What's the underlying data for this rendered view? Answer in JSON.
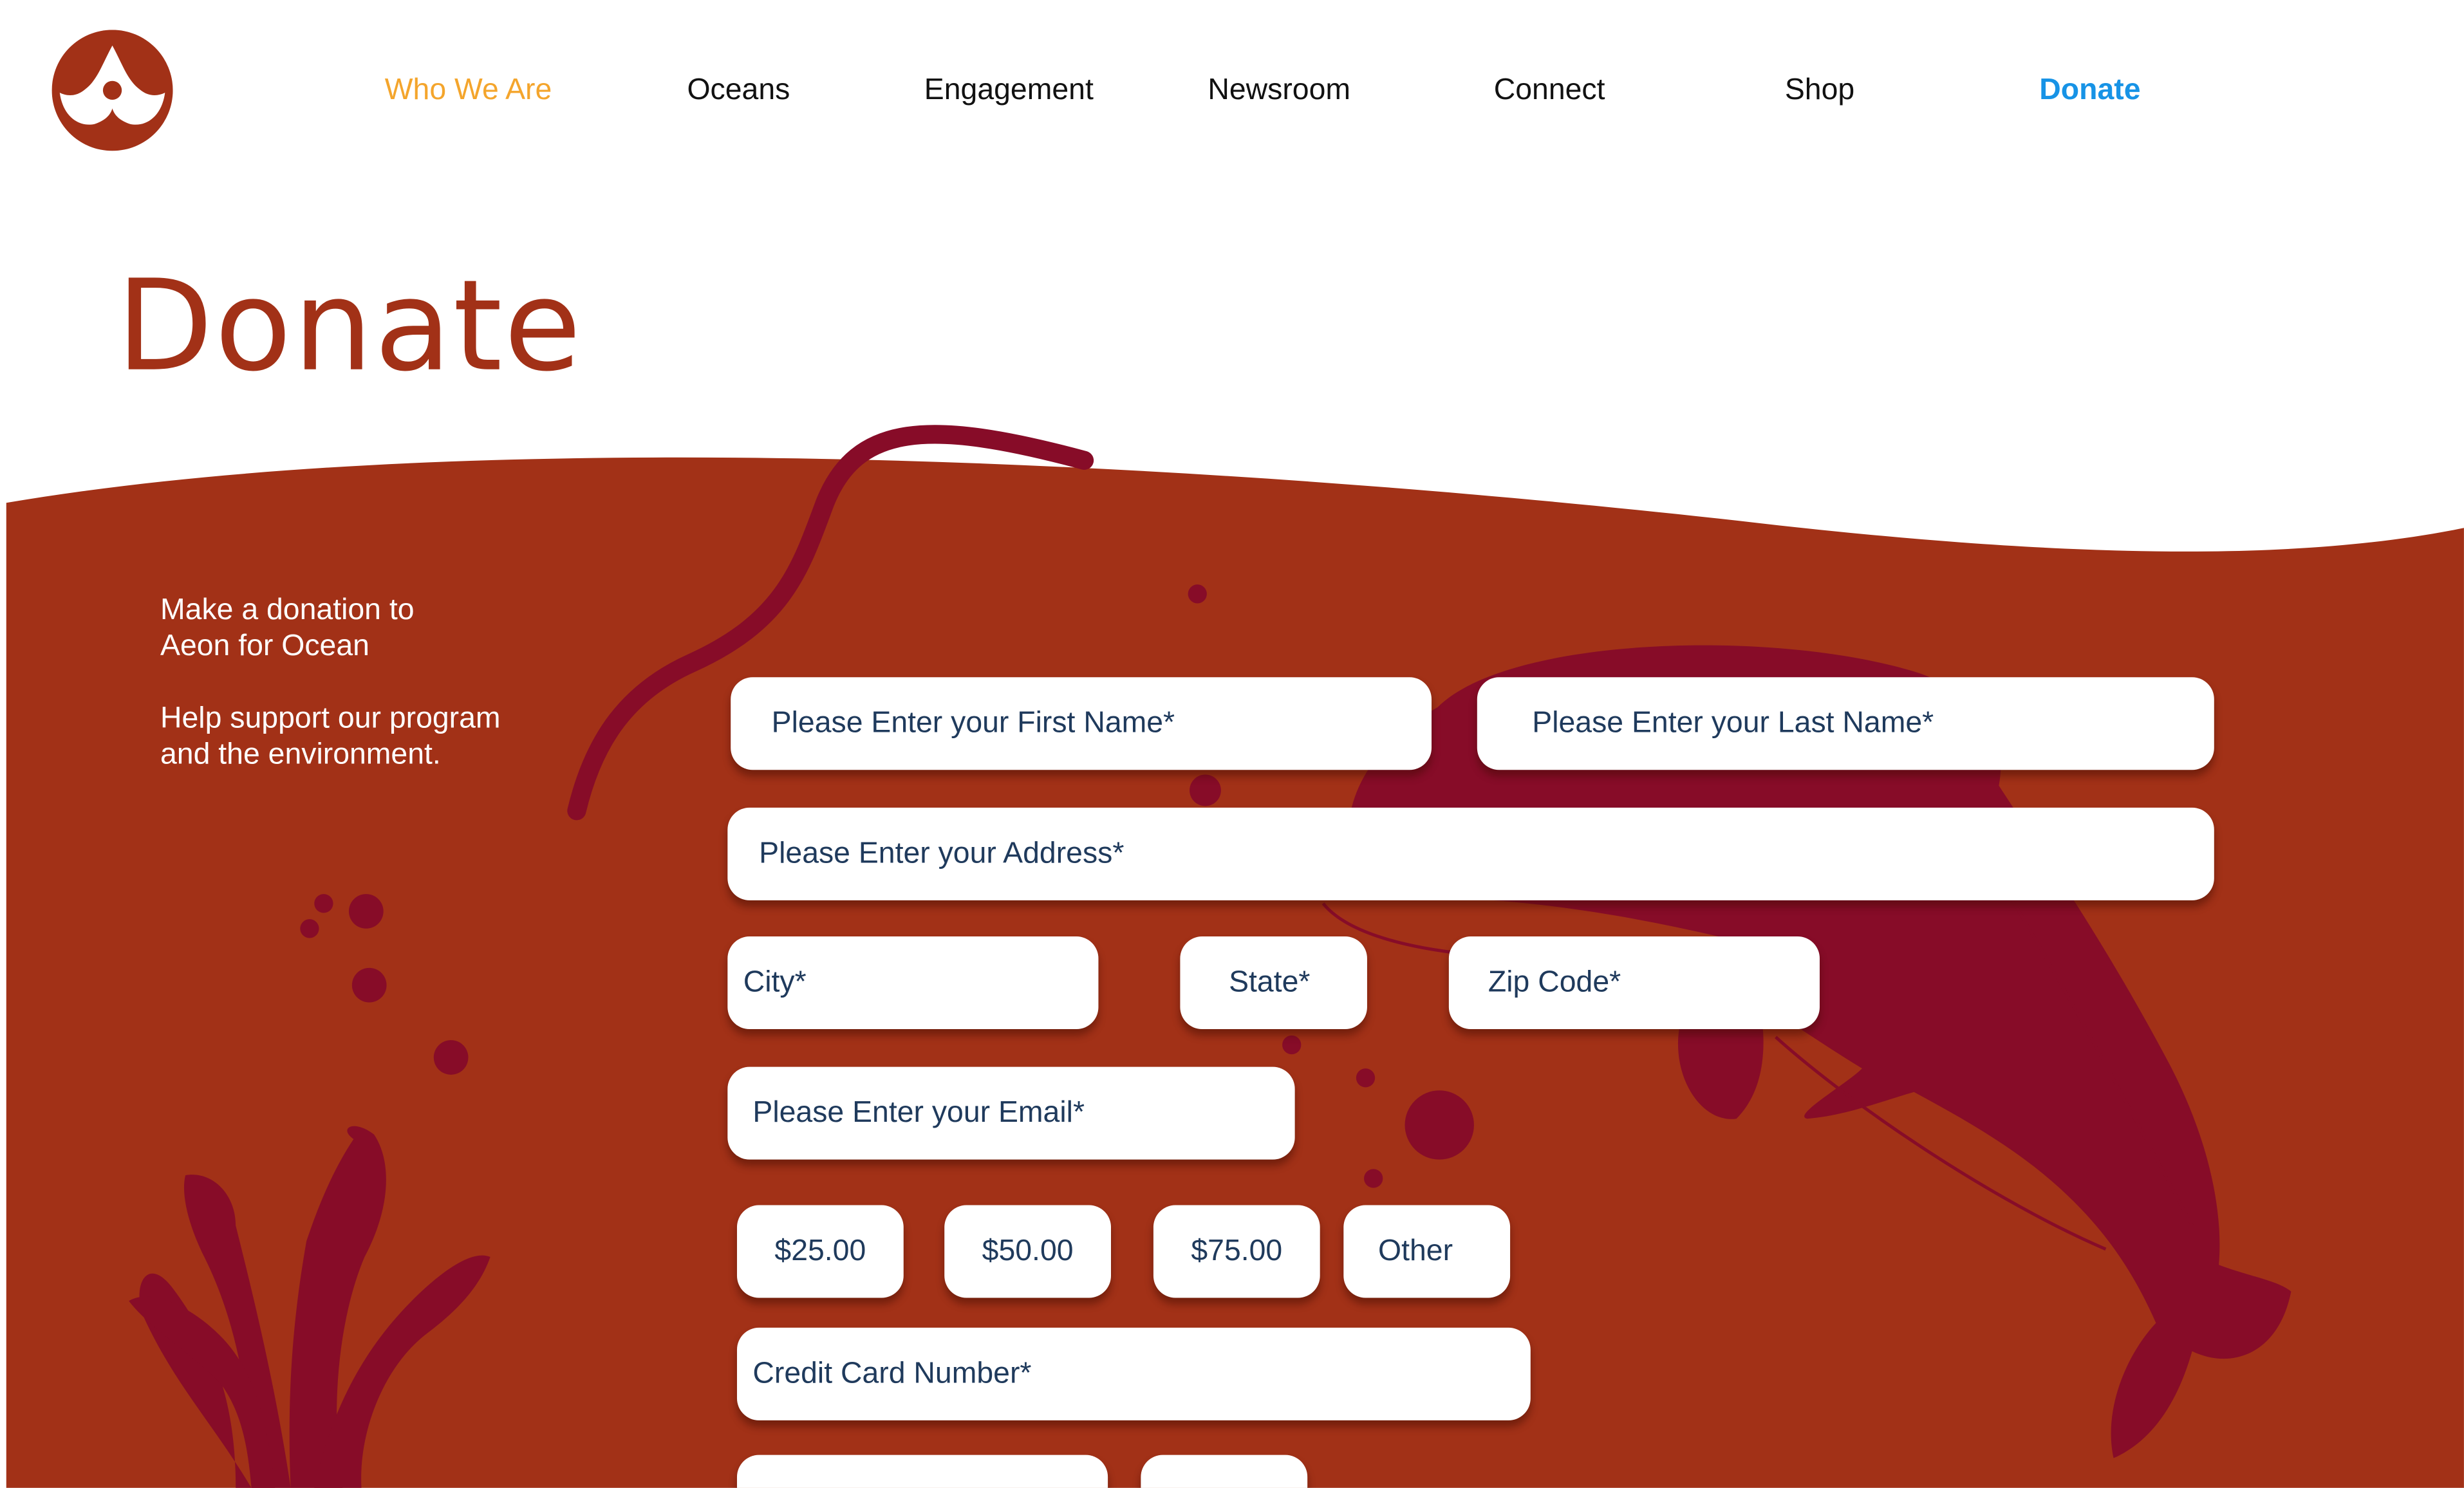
{
  "nav": {
    "items": [
      {
        "label": "Who We Are",
        "state": "active"
      },
      {
        "label": "Oceans",
        "state": "normal"
      },
      {
        "label": "Engagement",
        "state": "normal"
      },
      {
        "label": "Newsroom",
        "state": "normal"
      },
      {
        "label": "Connect",
        "state": "normal"
      },
      {
        "label": "Shop",
        "state": "normal"
      },
      {
        "label": "Donate",
        "state": "highlight"
      }
    ]
  },
  "page": {
    "title": "Donate"
  },
  "intro": {
    "line1": "Make a donation to",
    "line2": "Aeon for Ocean",
    "line3": "Help support our program",
    "line4": "and the environment."
  },
  "form": {
    "first_name": "Please Enter your First Name*",
    "last_name": "Please Enter your Last Name*",
    "address": "Please Enter your Address*",
    "city": "City*",
    "state": "State*",
    "zip": "Zip Code*",
    "email": "Please Enter your Email*",
    "amounts": [
      "$25.00",
      "$50.00",
      "$75.00",
      "Other"
    ],
    "card_number": "Credit Card Number*"
  },
  "colors": {
    "brand": "#a23117",
    "dark_art": "#870c28",
    "nav_active": "#f4a52c",
    "nav_donate": "#1793e6",
    "field_text": "#1f3a5c"
  },
  "icons": {
    "logo": "whale-tail-logo-icon"
  }
}
